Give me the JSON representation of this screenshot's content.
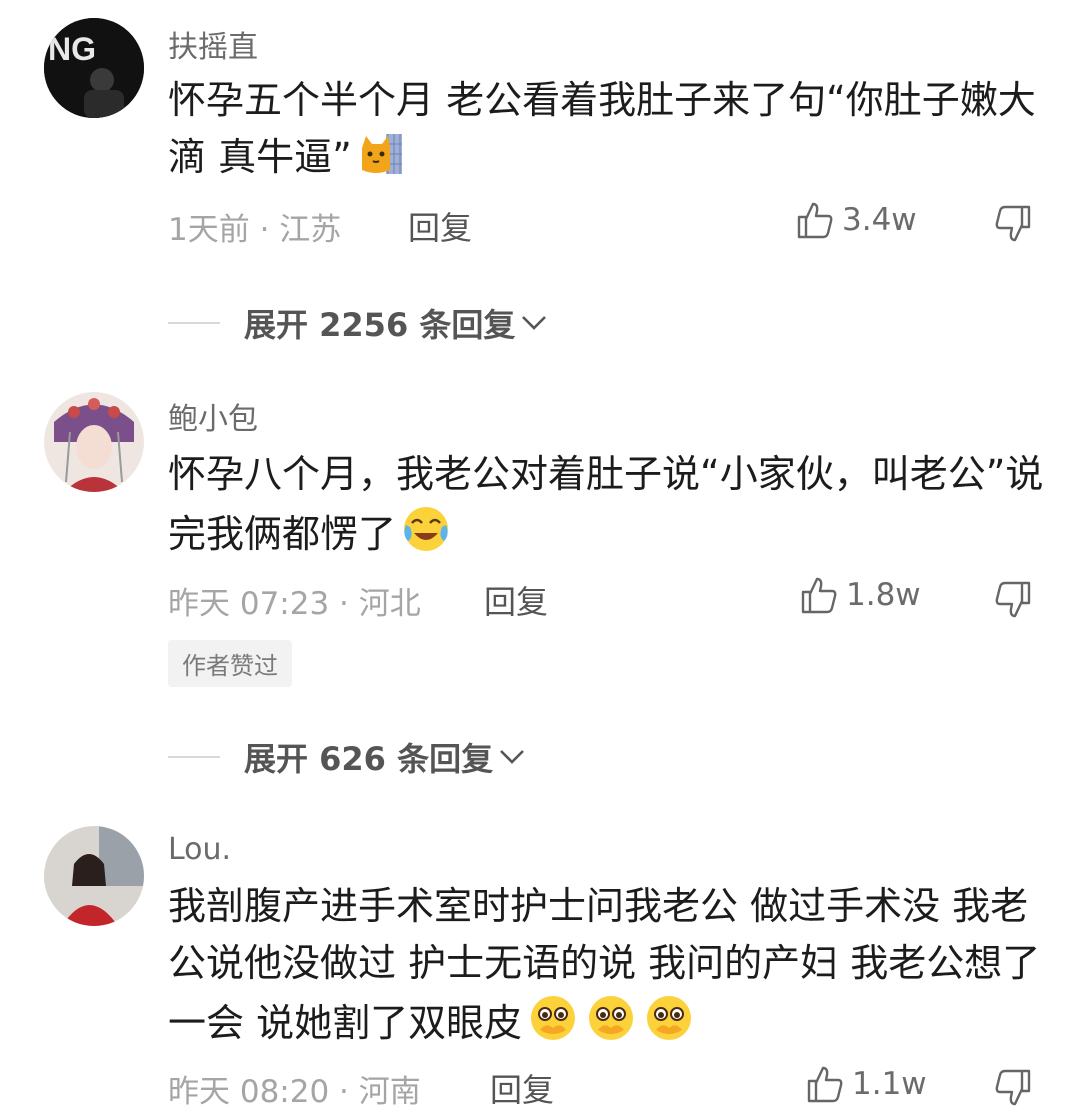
{
  "comments": [
    {
      "username": "扶摇直",
      "text": "怀孕五个半个月 老公看着我肚子来了句“你肚子嫩大滴 真牛逼”",
      "time_loc": "1天前 · 江苏",
      "reply_label": "回复",
      "likes": "3.4w",
      "expand_label": "展开 2256 条回复",
      "avatar_logo": "NG"
    },
    {
      "username": "鲍小包",
      "text": "怀孕八个月，我老公对着肚子说“小家伙，叫老公”说完我俩都愣了",
      "time_loc": "昨天 07:23 · 河北",
      "reply_label": "回复",
      "likes": "1.8w",
      "badge": "作者赞过",
      "expand_label": "展开 626 条回复"
    },
    {
      "username": "Lou.",
      "text": "我剖腹产进手术室时护士问我老公 做过手术没 我老公说他没做过 护士无语的说 我问的产妇 我老公想了一会 说她割了双眼皮",
      "time_loc": "昨天 08:20 · 河南",
      "reply_label": "回复",
      "likes": "1.1w"
    }
  ]
}
